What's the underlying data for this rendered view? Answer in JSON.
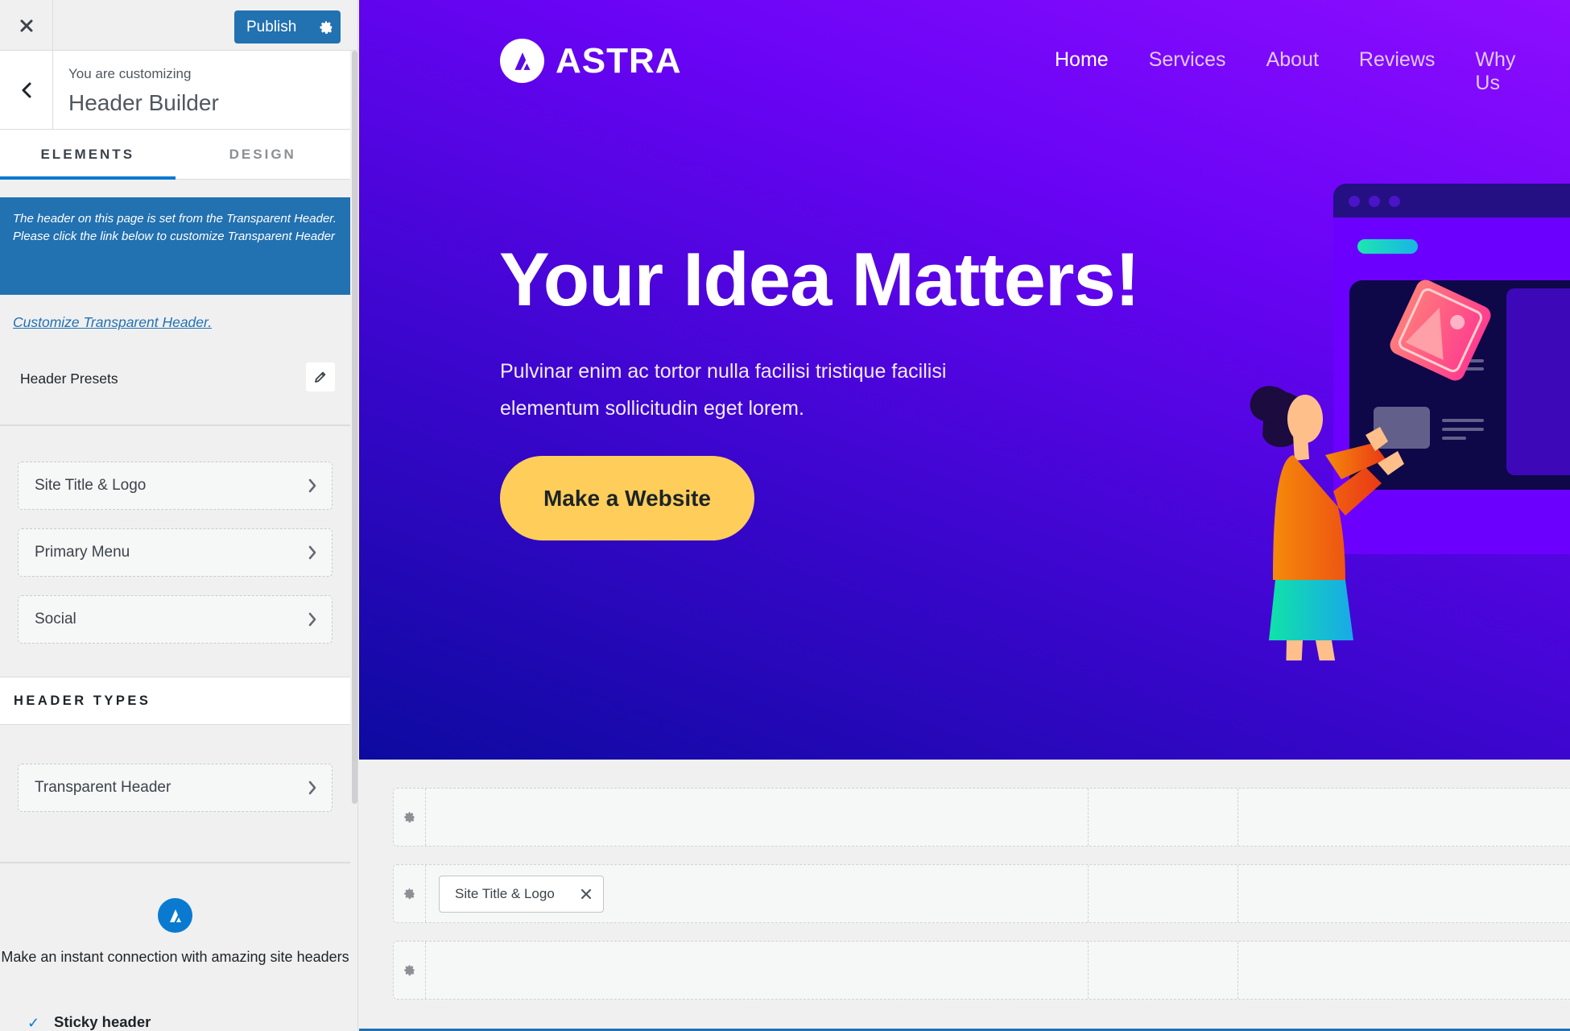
{
  "sidebar": {
    "close_icon": "close-icon",
    "publish_label": "Publish",
    "context_subtitle": "You are customizing",
    "context_title": "Header Builder",
    "tabs": [
      {
        "label": "ELEMENTS",
        "active": true
      },
      {
        "label": "DESIGN",
        "active": false
      }
    ],
    "notice_line1": "The header on this page is set from the Transparent Header.",
    "notice_line2": "Please click the link below to customize Transparent Header",
    "customize_link": "Customize Transparent Header.",
    "presets_label": "Header Presets",
    "elements": [
      {
        "label": "Site Title & Logo"
      },
      {
        "label": "Primary Menu"
      },
      {
        "label": "Social"
      }
    ],
    "header_types_heading": "HEADER TYPES",
    "header_types": [
      {
        "label": "Transparent Header"
      }
    ],
    "promo_text": "Make an instant connection with amazing site headers",
    "promo_feature": "Sticky header"
  },
  "preview": {
    "logo_text": "ASTRA",
    "nav": [
      {
        "label": "Home",
        "current": true
      },
      {
        "label": "Services",
        "current": false
      },
      {
        "label": "About",
        "current": false
      },
      {
        "label": "Reviews",
        "current": false
      },
      {
        "label": "Why Us",
        "current": false
      }
    ],
    "hero_title": "Your Idea Matters!",
    "hero_description": "Pulvinar enim ac tortor nulla facilisi tristique facilisi elementum sollicitudin eget lorem.",
    "cta_label": "Make a Website",
    "colors": {
      "cta": "#ffce5a",
      "accent": "#2271b1"
    }
  },
  "builder": {
    "rows": [
      {
        "name": "above-header",
        "items": []
      },
      {
        "name": "primary-header",
        "items": [
          {
            "label": "Site Title & Logo"
          }
        ]
      },
      {
        "name": "below-header",
        "items": []
      }
    ]
  }
}
